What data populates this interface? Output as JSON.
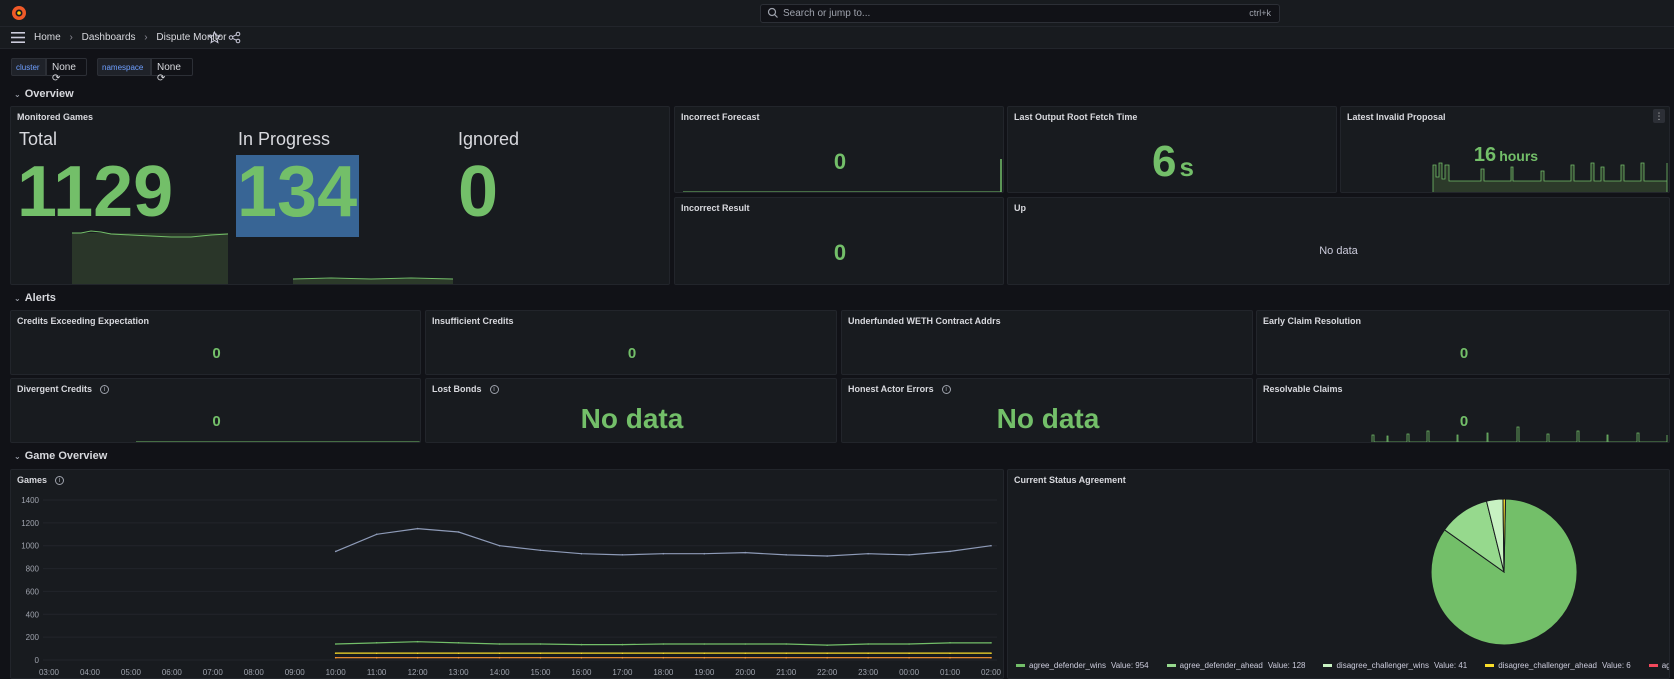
{
  "topbar": {
    "search_placeholder": "Search or jump to...",
    "shortcut": "ctrl+k"
  },
  "breadcrumb": {
    "items": [
      "Home",
      "Dashboards",
      "Dispute Monitor"
    ]
  },
  "variables": [
    {
      "label": "cluster",
      "value": "None"
    },
    {
      "label": "namespace",
      "value": "None"
    }
  ],
  "rows": {
    "overview": "Overview",
    "alerts": "Alerts",
    "game_overview": "Game Overview"
  },
  "monitored_games": {
    "title": "Monitored Games",
    "total_label": "Total",
    "total_value": "1129",
    "in_progress_label": "In Progress",
    "in_progress_value": "134",
    "ignored_label": "Ignored",
    "ignored_value": "0"
  },
  "overview_panels": {
    "incorrect_forecast": {
      "title": "Incorrect Forecast",
      "value": "0"
    },
    "incorrect_result": {
      "title": "Incorrect Result",
      "value": "0"
    },
    "last_output_root_fetch_time": {
      "title": "Last Output Root Fetch Time",
      "value": "6",
      "unit": "s"
    },
    "latest_invalid_proposal": {
      "title": "Latest Invalid Proposal",
      "value": "16",
      "unit": "hours"
    },
    "up": {
      "title": "Up",
      "value": "No data"
    }
  },
  "alert_panels": {
    "credits_exceeding": {
      "title": "Credits Exceeding Expectation",
      "value": "0"
    },
    "insufficient_credits": {
      "title": "Insufficient Credits",
      "value": "0"
    },
    "underfunded_weth": {
      "title": "Underfunded WETH Contract Addrs",
      "value": ""
    },
    "early_claim": {
      "title": "Early Claim Resolution",
      "value": "0"
    },
    "divergent_credits": {
      "title": "Divergent Credits",
      "value": "0"
    },
    "lost_bonds": {
      "title": "Lost Bonds",
      "value": "No data"
    },
    "honest_actor_errors": {
      "title": "Honest Actor Errors",
      "value": "No data"
    },
    "resolvable_claims": {
      "title": "Resolvable Claims",
      "value": "0"
    }
  },
  "games_panel": {
    "title": "Games"
  },
  "status_panel": {
    "title": "Current Status Agreement",
    "legend": [
      {
        "name": "agree_defender_wins",
        "value_text": "Value: 954",
        "color": "#73bf69"
      },
      {
        "name": "agree_defender_ahead",
        "value_text": "Value: 128",
        "color": "#96d98d"
      },
      {
        "name": "disagree_challenger_wins",
        "value_text": "Value: 41",
        "color": "#c8f2c2"
      },
      {
        "name": "disagree_challenger_ahead",
        "value_text": "Value: 6",
        "color": "#fade2a"
      },
      {
        "name": "agree_challenger_wins",
        "value_text": "",
        "color": "#f2495c"
      }
    ]
  },
  "chart_data": [
    {
      "type": "line",
      "title": "Games",
      "x": [
        "03:00",
        "04:00",
        "05:00",
        "06:00",
        "07:00",
        "08:00",
        "09:00",
        "10:00",
        "11:00",
        "12:00",
        "13:00",
        "14:00",
        "15:00",
        "16:00",
        "17:00",
        "18:00",
        "19:00",
        "20:00",
        "21:00",
        "22:00",
        "23:00",
        "00:00",
        "01:00",
        "02:00"
      ],
      "ylim": [
        0,
        1400
      ],
      "yticks": [
        "1400",
        "1200",
        "1000",
        "800",
        "600",
        "400",
        "200",
        "0"
      ],
      "series": [
        {
          "color": "#8e9bb8",
          "values": [
            null,
            null,
            null,
            null,
            null,
            null,
            null,
            950,
            1100,
            1150,
            1120,
            1000,
            960,
            930,
            920,
            930,
            930,
            940,
            920,
            910,
            930,
            920,
            950,
            1000
          ]
        },
        {
          "color": "#73bf69",
          "values": [
            null,
            null,
            null,
            null,
            null,
            null,
            null,
            140,
            150,
            160,
            150,
            140,
            140,
            135,
            135,
            140,
            140,
            140,
            140,
            130,
            140,
            140,
            150,
            150
          ]
        },
        {
          "color": "#fade2a",
          "values": [
            null,
            null,
            null,
            null,
            null,
            null,
            null,
            60,
            60,
            60,
            60,
            60,
            60,
            60,
            60,
            60,
            60,
            60,
            60,
            60,
            60,
            60,
            60,
            60
          ]
        },
        {
          "color": "#ff9830",
          "values": [
            null,
            null,
            null,
            null,
            null,
            null,
            null,
            20,
            20,
            20,
            20,
            20,
            20,
            20,
            20,
            20,
            20,
            20,
            20,
            20,
            20,
            20,
            20,
            20
          ]
        }
      ],
      "grid": true
    },
    {
      "type": "pie",
      "title": "Current Status Agreement",
      "categories": [
        "agree_defender_wins",
        "agree_defender_ahead",
        "disagree_challenger_wins",
        "disagree_challenger_ahead",
        "agree_challenger_wins"
      ],
      "values": [
        954,
        128,
        41,
        6,
        0
      ]
    }
  ]
}
